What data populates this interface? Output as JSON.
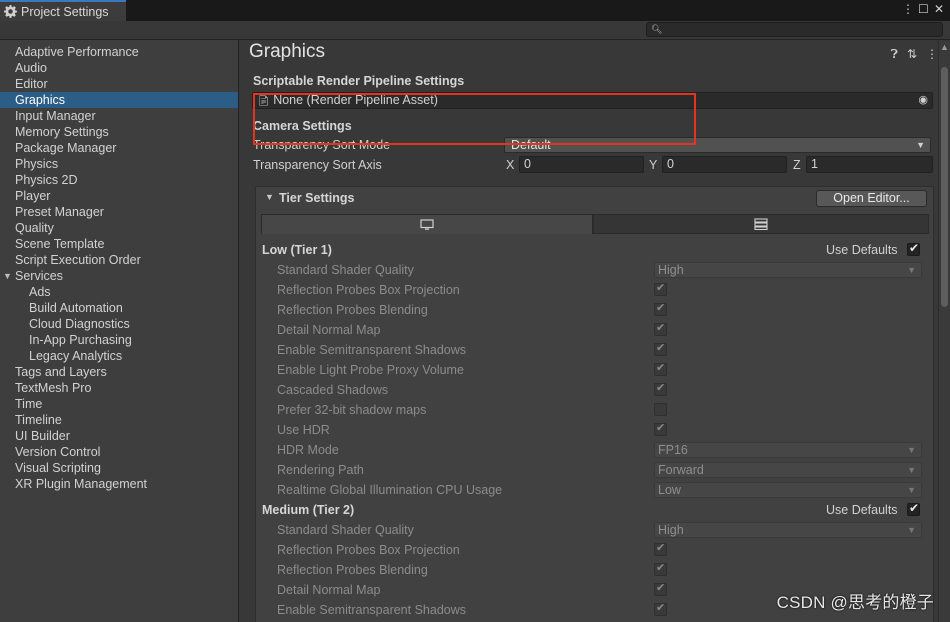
{
  "window": {
    "tab_title": "Project Settings",
    "controls": [
      "⋮",
      "☐",
      "✕"
    ]
  },
  "search": {
    "placeholder": ""
  },
  "sidebar": {
    "items": [
      {
        "label": "Adaptive Performance"
      },
      {
        "label": "Audio"
      },
      {
        "label": "Editor"
      },
      {
        "label": "Graphics",
        "selected": true
      },
      {
        "label": "Input Manager"
      },
      {
        "label": "Memory Settings"
      },
      {
        "label": "Package Manager"
      },
      {
        "label": "Physics"
      },
      {
        "label": "Physics 2D"
      },
      {
        "label": "Player"
      },
      {
        "label": "Preset Manager"
      },
      {
        "label": "Quality"
      },
      {
        "label": "Scene Template"
      },
      {
        "label": "Script Execution Order"
      },
      {
        "label": "Services",
        "expanded": true
      },
      {
        "label": "Ads",
        "sub": true
      },
      {
        "label": "Build Automation",
        "sub": true
      },
      {
        "label": "Cloud Diagnostics",
        "sub": true
      },
      {
        "label": "In-App Purchasing",
        "sub": true
      },
      {
        "label": "Legacy Analytics",
        "sub": true
      },
      {
        "label": "Tags and Layers"
      },
      {
        "label": "TextMesh Pro"
      },
      {
        "label": "Time"
      },
      {
        "label": "Timeline"
      },
      {
        "label": "UI Builder"
      },
      {
        "label": "Version Control"
      },
      {
        "label": "Visual Scripting"
      },
      {
        "label": "XR Plugin Management"
      }
    ]
  },
  "main": {
    "title": "Graphics",
    "srp": {
      "heading": "Scriptable Render Pipeline Settings",
      "value": "None (Render Pipeline Asset)"
    },
    "camera": {
      "heading": "Camera Settings",
      "sort_mode_label": "Transparency Sort Mode",
      "sort_mode_value": "Default",
      "sort_axis_label": "Transparency Sort Axis",
      "x_label": "X",
      "x_value": "0",
      "y_label": "Y",
      "y_value": "0",
      "z_label": "Z",
      "z_value": "1"
    },
    "tier_settings": {
      "heading": "Tier Settings",
      "open_editor": "Open Editor...",
      "tiers": [
        {
          "name": "Low (Tier 1)",
          "use_defaults_label": "Use Defaults",
          "use_defaults": true,
          "rows": [
            {
              "label": "Standard Shader Quality",
              "type": "dropdown",
              "value": "High"
            },
            {
              "label": "Reflection Probes Box Projection",
              "type": "check",
              "value": true
            },
            {
              "label": "Reflection Probes Blending",
              "type": "check",
              "value": true
            },
            {
              "label": "Detail Normal Map",
              "type": "check",
              "value": true
            },
            {
              "label": "Enable Semitransparent Shadows",
              "type": "check",
              "value": true
            },
            {
              "label": "Enable Light Probe Proxy Volume",
              "type": "check",
              "value": true
            },
            {
              "label": "Cascaded Shadows",
              "type": "check",
              "value": true
            },
            {
              "label": "Prefer 32-bit shadow maps",
              "type": "check",
              "value": false
            },
            {
              "label": "Use HDR",
              "type": "check",
              "value": true
            },
            {
              "label": "HDR Mode",
              "type": "dropdown",
              "value": "FP16"
            },
            {
              "label": "Rendering Path",
              "type": "dropdown",
              "value": "Forward"
            },
            {
              "label": "Realtime Global Illumination CPU Usage",
              "type": "dropdown",
              "value": "Low"
            }
          ]
        },
        {
          "name": "Medium (Tier 2)",
          "use_defaults_label": "Use Defaults",
          "use_defaults": true,
          "rows": [
            {
              "label": "Standard Shader Quality",
              "type": "dropdown",
              "value": "High"
            },
            {
              "label": "Reflection Probes Box Projection",
              "type": "check",
              "value": true
            },
            {
              "label": "Reflection Probes Blending",
              "type": "check",
              "value": true
            },
            {
              "label": "Detail Normal Map",
              "type": "check",
              "value": true
            },
            {
              "label": "Enable Semitransparent Shadows",
              "type": "check",
              "value": true
            }
          ]
        }
      ]
    }
  },
  "watermark": "CSDN @思考的橙子"
}
